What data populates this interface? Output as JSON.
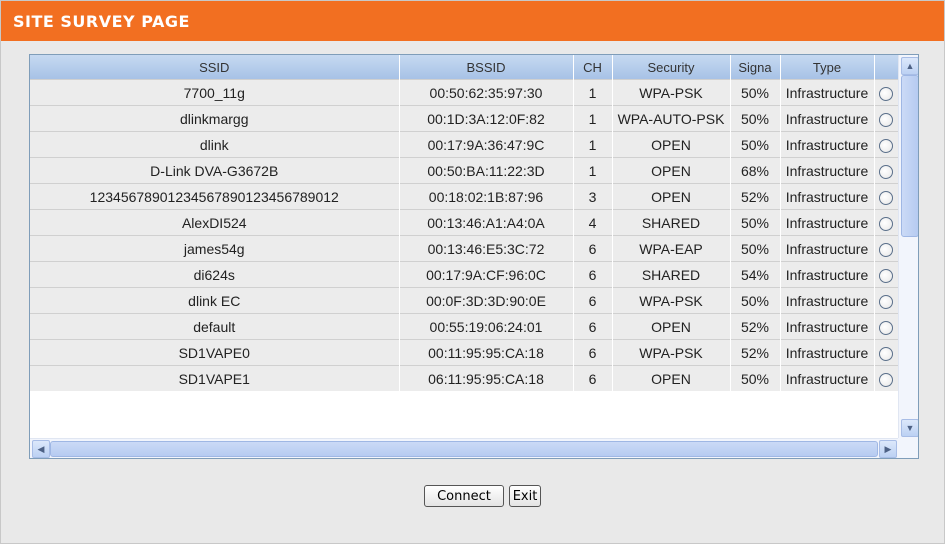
{
  "header": {
    "title": "SITE SURVEY PAGE"
  },
  "table": {
    "columns": [
      "SSID",
      "BSSID",
      "CH",
      "Security",
      "Signa",
      "Type",
      ""
    ],
    "rows": [
      {
        "ssid": "7700_11g",
        "bssid": "00:50:62:35:97:30",
        "ch": "1",
        "security": "WPA-PSK",
        "signal": "50%",
        "type": "Infrastructure"
      },
      {
        "ssid": "dlinkmargg",
        "bssid": "00:1D:3A:12:0F:82",
        "ch": "1",
        "security": "WPA-AUTO-PSK",
        "signal": "50%",
        "type": "Infrastructure"
      },
      {
        "ssid": "dlink",
        "bssid": "00:17:9A:36:47:9C",
        "ch": "1",
        "security": "OPEN",
        "signal": "50%",
        "type": "Infrastructure"
      },
      {
        "ssid": "D-Link DVA-G3672B",
        "bssid": "00:50:BA:11:22:3D",
        "ch": "1",
        "security": "OPEN",
        "signal": "68%",
        "type": "Infrastructure"
      },
      {
        "ssid": "12345678901234567890123456789012",
        "bssid": "00:18:02:1B:87:96",
        "ch": "3",
        "security": "OPEN",
        "signal": "52%",
        "type": "Infrastructure"
      },
      {
        "ssid": "AlexDI524",
        "bssid": "00:13:46:A1:A4:0A",
        "ch": "4",
        "security": "SHARED",
        "signal": "50%",
        "type": "Infrastructure"
      },
      {
        "ssid": "james54g",
        "bssid": "00:13:46:E5:3C:72",
        "ch": "6",
        "security": "WPA-EAP",
        "signal": "50%",
        "type": "Infrastructure"
      },
      {
        "ssid": "di624s",
        "bssid": "00:17:9A:CF:96:0C",
        "ch": "6",
        "security": "SHARED",
        "signal": "54%",
        "type": "Infrastructure"
      },
      {
        "ssid": "dlink EC",
        "bssid": "00:0F:3D:3D:90:0E",
        "ch": "6",
        "security": "WPA-PSK",
        "signal": "50%",
        "type": "Infrastructure"
      },
      {
        "ssid": "default",
        "bssid": "00:55:19:06:24:01",
        "ch": "6",
        "security": "OPEN",
        "signal": "52%",
        "type": "Infrastructure"
      },
      {
        "ssid": "SD1VAPE0",
        "bssid": "00:11:95:95:CA:18",
        "ch": "6",
        "security": "WPA-PSK",
        "signal": "52%",
        "type": "Infrastructure"
      },
      {
        "ssid": "SD1VAPE1",
        "bssid": "06:11:95:95:CA:18",
        "ch": "6",
        "security": "OPEN",
        "signal": "50%",
        "type": "Infrastructure"
      }
    ]
  },
  "buttons": {
    "connect": "Connect",
    "exit": "Exit"
  },
  "colors": {
    "header": "#f26f21",
    "table_header": "#b8cfed",
    "row": "#ececec"
  }
}
